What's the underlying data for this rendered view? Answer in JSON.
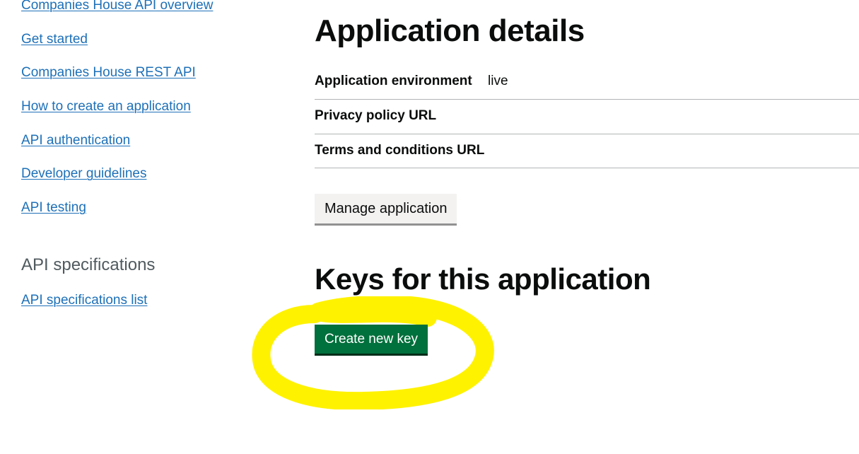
{
  "sidebar": {
    "links": [
      "Companies House API overview",
      "Get started",
      "Companies House REST API",
      "How to create an application",
      "API authentication",
      "Developer guidelines",
      "API testing"
    ],
    "section_label": "API specifications",
    "spec_links": [
      "API specifications list"
    ]
  },
  "main": {
    "title": "Application details",
    "details": [
      {
        "key": "Application environment",
        "value": "live"
      },
      {
        "key": "Privacy policy URL",
        "value": ""
      },
      {
        "key": "Terms and conditions URL",
        "value": ""
      }
    ],
    "manage_button": "Manage application",
    "keys_title": "Keys for this application",
    "create_key_button": "Create new key"
  }
}
